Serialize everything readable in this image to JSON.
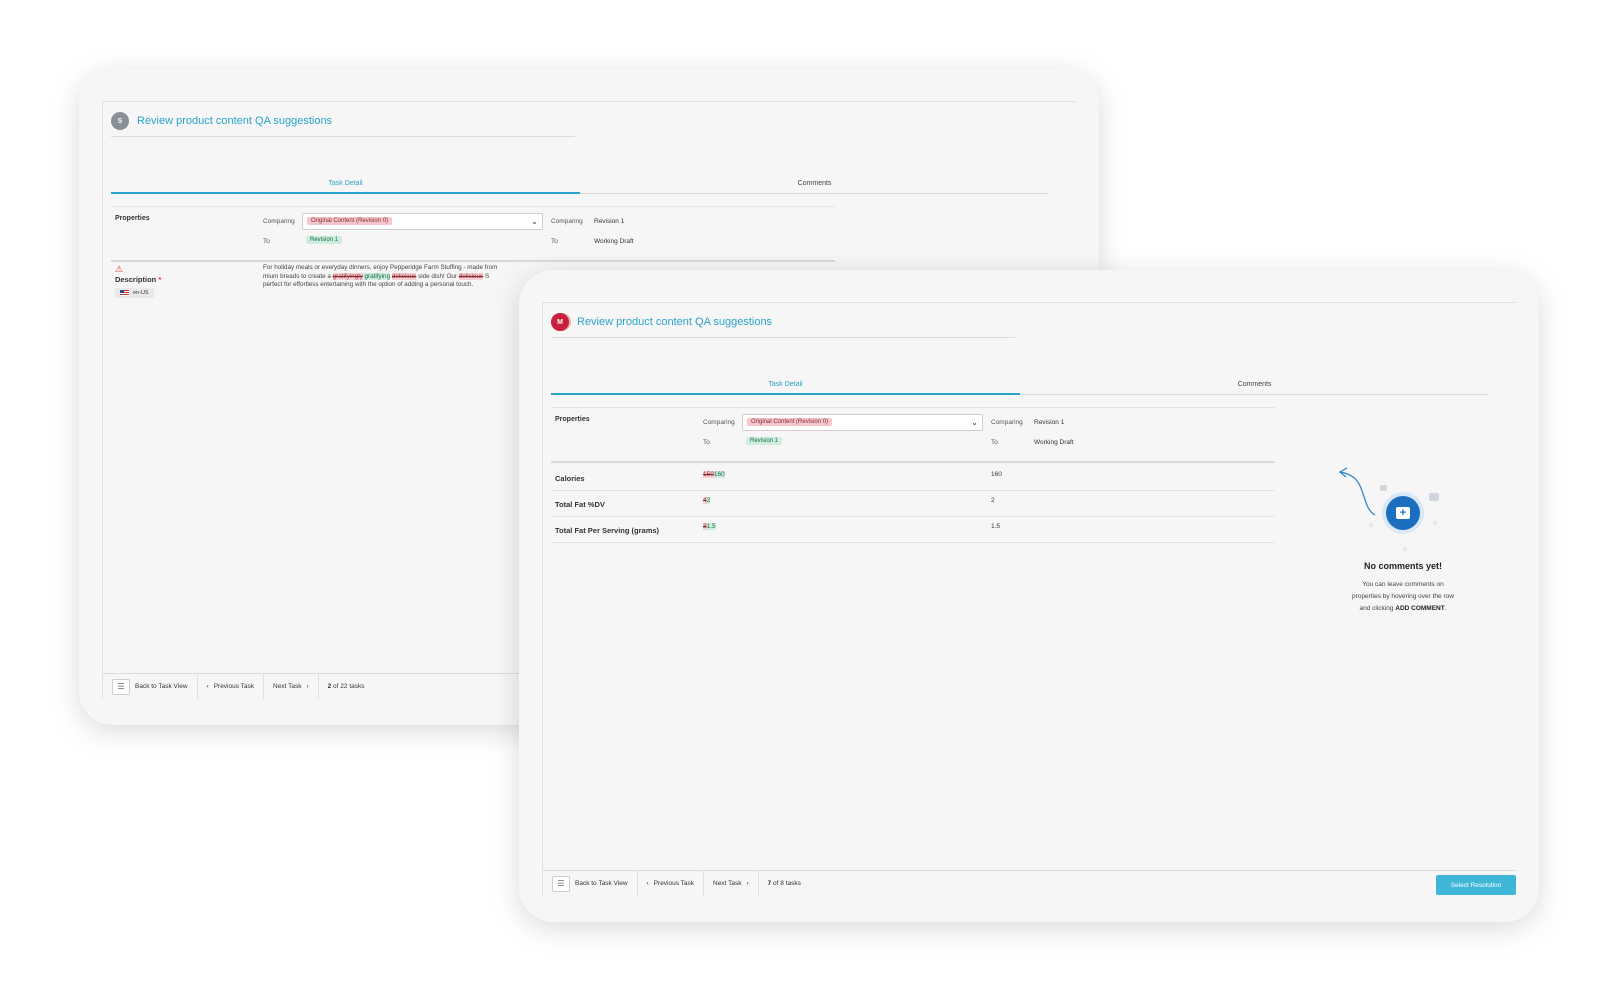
{
  "back_card": {
    "avatar_initial": "S",
    "title": "Review product content QA suggestions",
    "tabs": [
      "Task Detail",
      "Comments"
    ],
    "properties_label": "Properties",
    "comparing_label": "Comparing",
    "to_label": "To",
    "compare_from": "Original Content (Revision 0)",
    "compare_to": "Revision 1",
    "right_comparing": "Revision 1",
    "right_to": "Working Draft",
    "description_label": "Description",
    "required_mark": "*",
    "locale": "en-US",
    "desc_line1": "For holiday meals or everyday dinners, enjoy Pepperidge Farm Stuffing - made from",
    "desc_line2_a": "mium breads to create a ",
    "desc_line2_del1": "gratifyingly",
    "desc_line2_ins1": " gratifying",
    "desc_line2_del2": "delicious",
    "desc_line2_b": " side dish! Our ",
    "desc_line2_del3": "delicious",
    "desc_line2_c": " S",
    "desc_line3": "perfect for effortless entertaining with the option of adding a personal touch.",
    "footer": {
      "back": "Back to Task View",
      "prev": "Previous Task",
      "next": "Next Task",
      "count_num": "2",
      "count_rest": " of 22 tasks"
    }
  },
  "front_card": {
    "avatar_initial": "M",
    "title": "Review product content QA suggestions",
    "tabs": [
      "Task Detail",
      "Comments"
    ],
    "properties_label": "Properties",
    "comparing_label": "Comparing",
    "to_label": "To",
    "compare_from": "Original Content (Revision 0)",
    "compare_to": "Revision 1",
    "right_comparing": "Revision 1",
    "right_to": "Working Draft",
    "rows": [
      {
        "name": "Calories",
        "old": "150",
        "new": "160",
        "current": "160"
      },
      {
        "name": "Total Fat %DV",
        "old": "4",
        "new": "2",
        "current": "2"
      },
      {
        "name": "Total Fat Per Serving (grams)",
        "old": "3",
        "new": "1.5",
        "current": "1.5"
      }
    ],
    "empty_title": "No comments yet!",
    "empty_line1": "You can leave comments on",
    "empty_line2": "properties by hovering over the row",
    "empty_line3": "and clicking ",
    "empty_action": "ADD COMMENT",
    "empty_period": ".",
    "footer": {
      "back": "Back to Task View",
      "prev": "Previous Task",
      "next": "Next Task",
      "count_num": "7",
      "count_rest": " of 8 tasks",
      "resolve": "Select Resolution"
    }
  },
  "colors": {
    "accent": "#2aa3c9",
    "button": "#3fb5d8",
    "removed_bg": "#f5c6cb",
    "added_bg": "#cdeede",
    "avatar_red": "#c8203a",
    "comment_icon": "#1c6fc0"
  }
}
